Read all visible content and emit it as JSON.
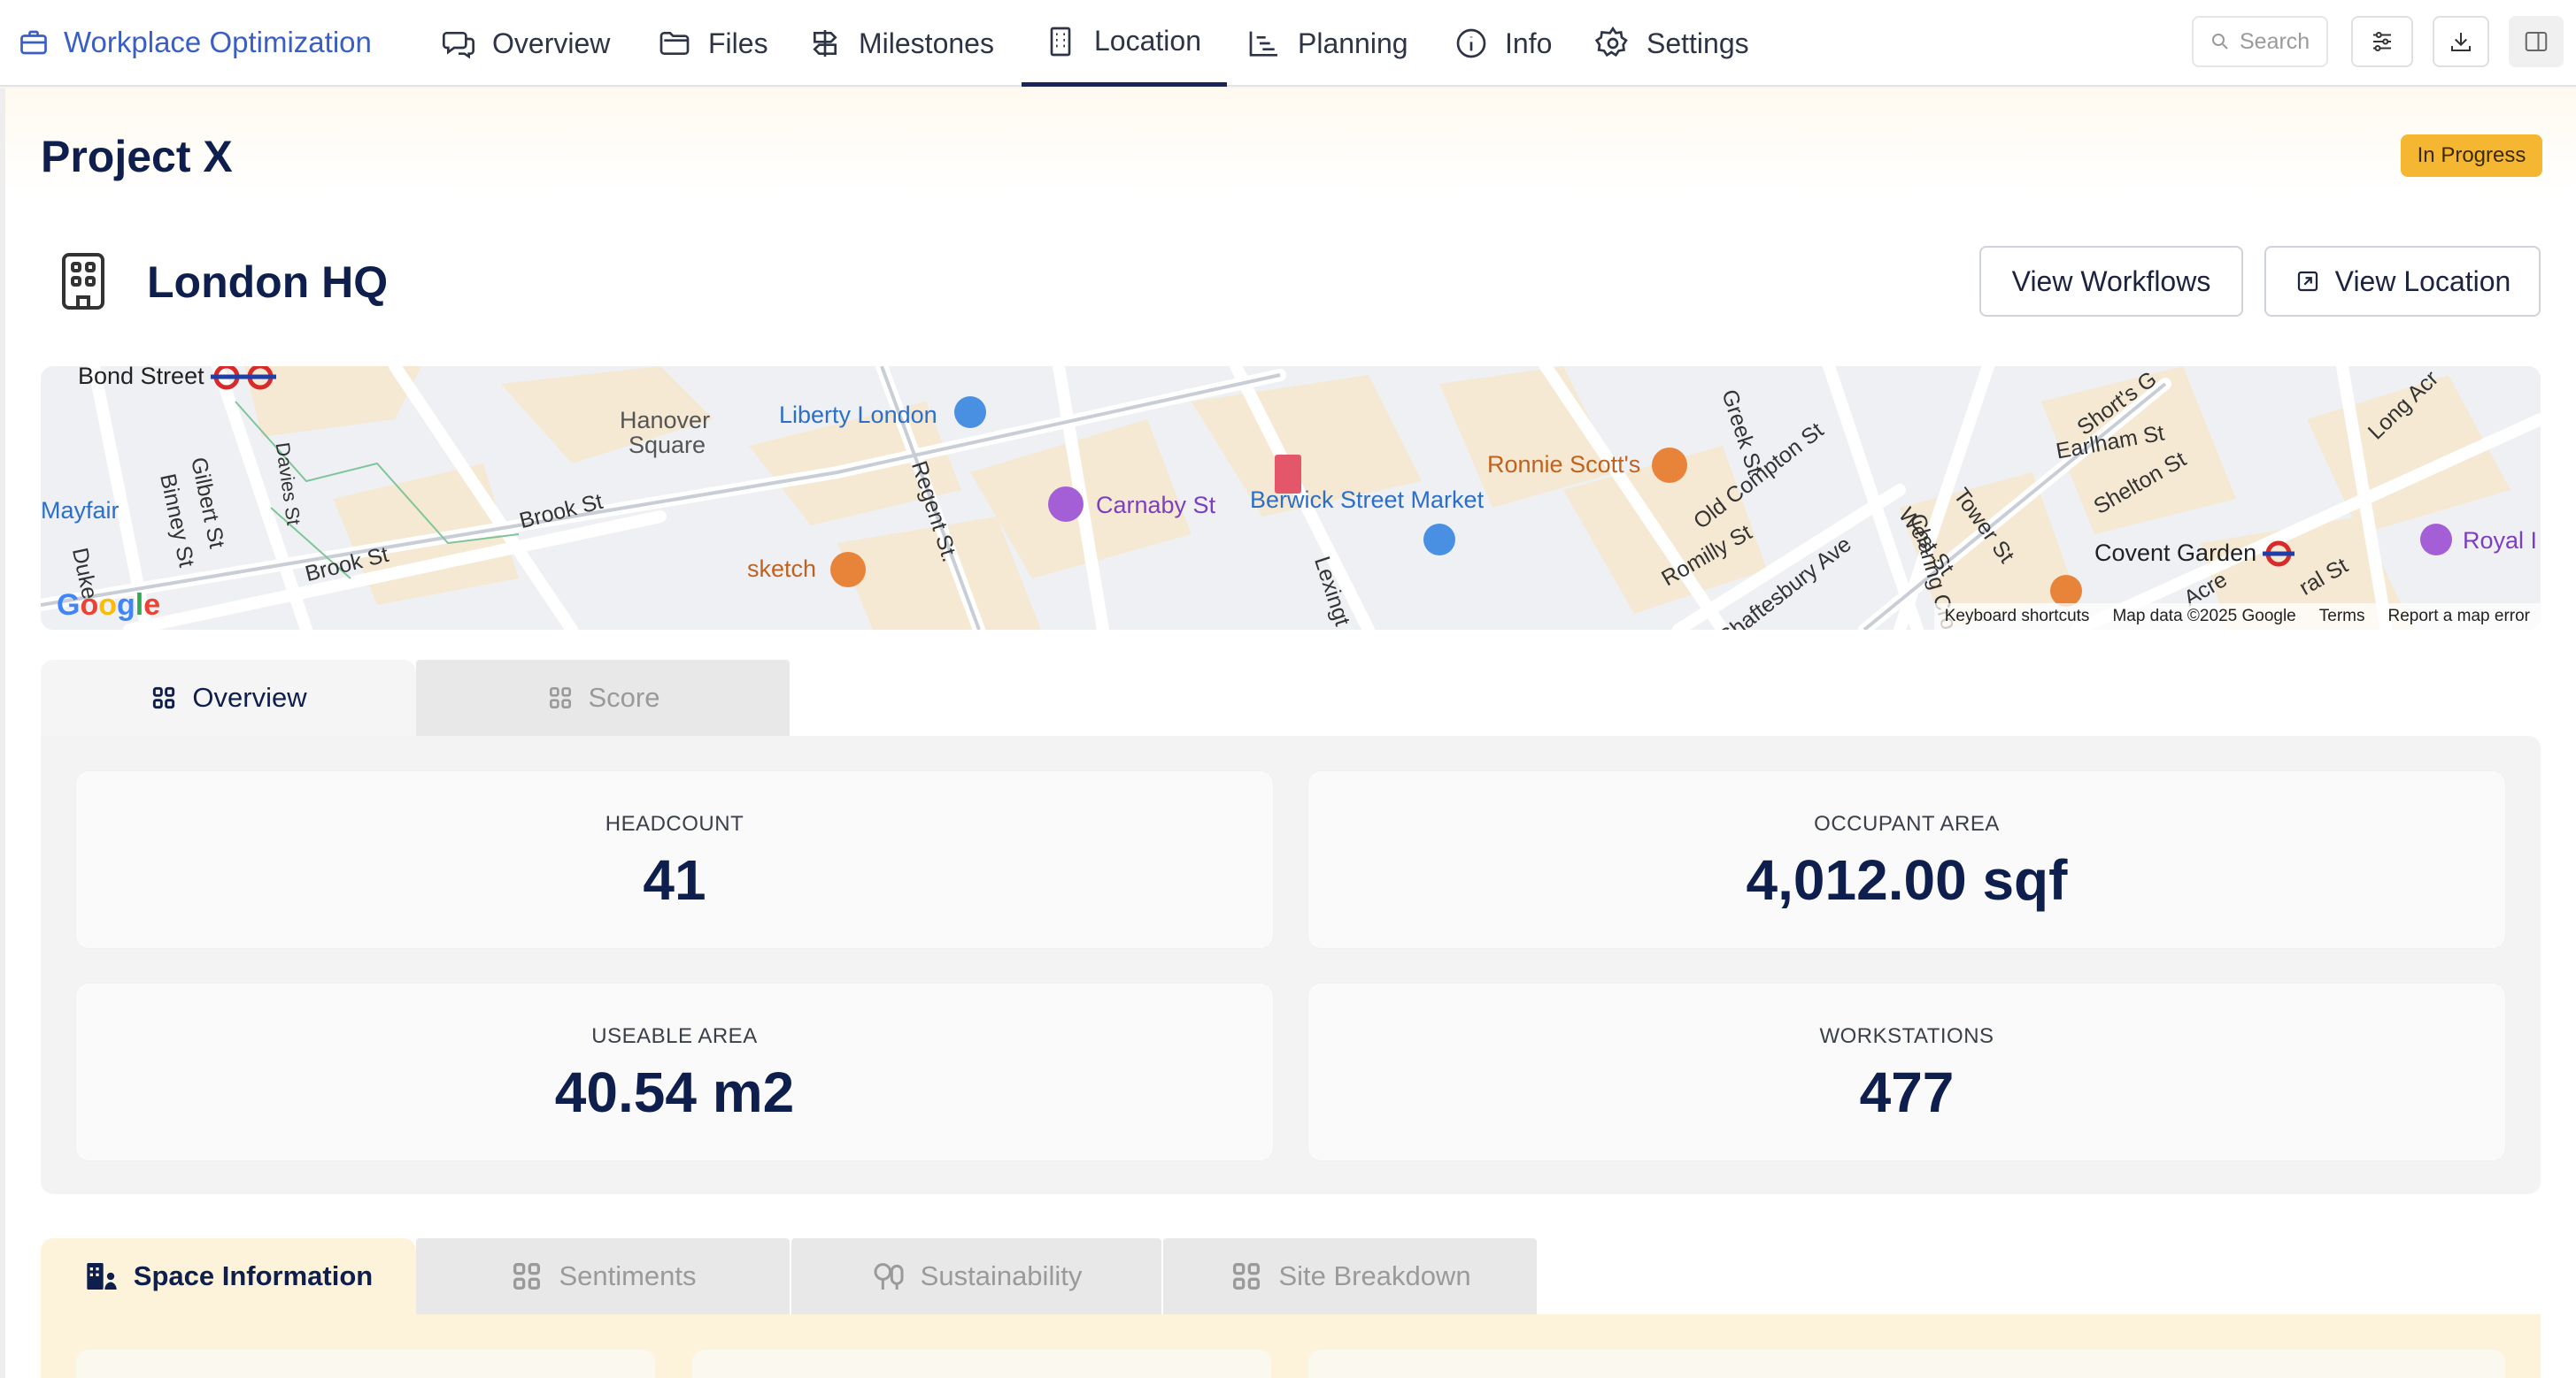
{
  "nav": {
    "brand": "Workplace Optimization",
    "items": [
      {
        "label": "Overview",
        "icon": "chat-icon"
      },
      {
        "label": "Files",
        "icon": "folder-icon"
      },
      {
        "label": "Milestones",
        "icon": "signpost-icon"
      },
      {
        "label": "Location",
        "icon": "building-icon"
      },
      {
        "label": "Planning",
        "icon": "gantt-icon"
      },
      {
        "label": "Info",
        "icon": "info-icon"
      },
      {
        "label": "Settings",
        "icon": "gear-icon"
      }
    ],
    "active": "Location",
    "search_placeholder": "Search"
  },
  "project": {
    "title": "Project X",
    "status": "In Progress",
    "status_color": "#f5b731"
  },
  "location": {
    "name": "London HQ",
    "buttons": {
      "workflows": "View Workflows",
      "location": "View Location"
    }
  },
  "map": {
    "labels": {
      "bond_street": "Bond Street",
      "liberty": "Liberty London",
      "hanover1": "Hanover",
      "hanover2": "Square",
      "mayfair": "Mayfair",
      "carnaby": "Carnaby St",
      "berwick": "Berwick Street Market",
      "ronnie": "Ronnie Scott's",
      "sketch": "sketch",
      "covent": "Covent Garden",
      "royal": "Royal I",
      "brook1": "Brook St",
      "brook2": "Brook St",
      "regent": "Regent St.",
      "greek": "Greek St",
      "old_compton": "Old Compton St",
      "romilly": "Romilly St",
      "shaftesbury": "Shaftesbury Ave",
      "charing": "Charing Cro",
      "west": "West St",
      "tower": "Tower St",
      "earlham": "Earlham St",
      "shelton": "Shelton St",
      "shorts": "Short's G",
      "long_acre": "Long Acr",
      "gilbert": "Gilbert St",
      "binney": "Binney St",
      "duke": "Duke",
      "davies": "Davies St",
      "lexington": "Lexingt",
      "acre": "Acre",
      "neal": "ral St"
    },
    "footer": {
      "shortcuts": "Keyboard shortcuts",
      "data": "Map data ©2025 Google",
      "terms": "Terms",
      "report": "Report a map error"
    },
    "logo": "Google"
  },
  "stats_tabs": [
    {
      "label": "Overview",
      "active": true
    },
    {
      "label": "Score",
      "active": false
    }
  ],
  "stats": {
    "headcount": {
      "label": "HEADCOUNT",
      "value": "41"
    },
    "occupant_area": {
      "label": "OCCUPANT AREA",
      "value": "4,012.00 sqf"
    },
    "useable_area": {
      "label": "USEABLE AREA",
      "value": "40.54 m2"
    },
    "workstations": {
      "label": "WORKSTATIONS",
      "value": "477"
    }
  },
  "detail_tabs": [
    {
      "label": "Space Information",
      "active": true
    },
    {
      "label": "Sentiments",
      "active": false
    },
    {
      "label": "Sustainability",
      "active": false
    },
    {
      "label": "Site Breakdown",
      "active": false
    }
  ],
  "colors": {
    "navy": "#0f1f4d",
    "brand_blue": "#3a5fc4",
    "badge": "#f5b731",
    "active_tab_bg": "#fdf3da"
  }
}
